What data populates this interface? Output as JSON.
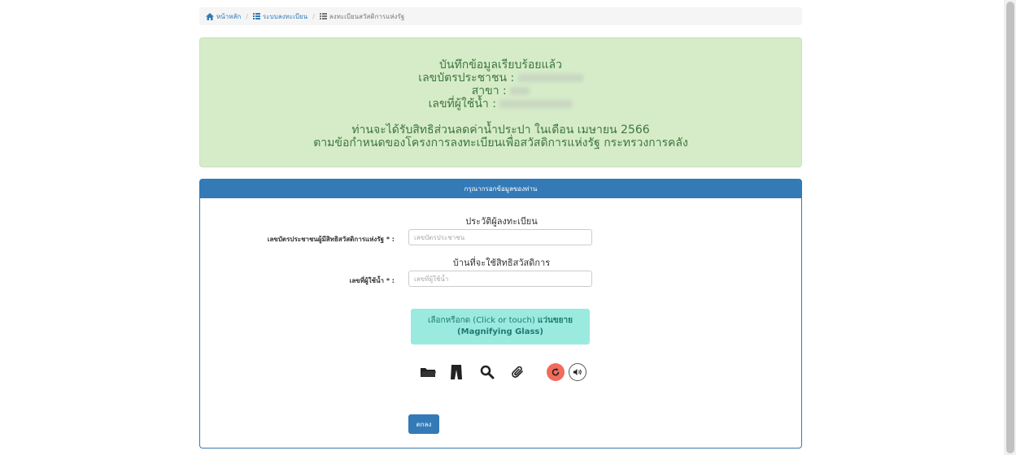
{
  "breadcrumb": {
    "home": "หน้าหลัก",
    "registration": "ระบบลงทะเบียน",
    "current": "ลงทะเบียนสวัสดิการแห่งรัฐ"
  },
  "alert": {
    "saved": "บันทึกข้อมูลเรียบร้อยแล้ว",
    "id_label": "เลขบัตรประชาชน :",
    "branch_label": "สาขา :",
    "user_no_label": "เลขที่ผู้ใช้น้ำ :",
    "discount_line": "ท่านจะได้รับสิทธิส่วนลดค่าน้ำประปา ในเดือน เมษายน 2566",
    "terms_line": "ตามข้อกำหนดของโครงการลงทะเบียนเพื่อสวัสดิการแห่งรัฐ กระทรวงการคลัง"
  },
  "panel": {
    "heading": "กรุณากรอกข้อมูลของท่าน",
    "section_registrant": "ประวัติผู้ลงทะเบียน",
    "id_field_label": "เลขบัตรประชาชนผู้มีสิทธิสวัสดิการแห่งรัฐ * :",
    "id_field_placeholder": "เลขบัตรประชาชน",
    "section_house": "บ้านที่จะใช้สิทธิสวัสดิการ",
    "user_no_field_label": "เลขที่ผู้ใช้น้ำ * :",
    "user_no_field_placeholder": "เลขที่ผู้ใช้น้ำ",
    "magnify_line1": "เลือกหรือกด (Click or touch)",
    "magnify_bold": "แว่นขยาย",
    "magnify_line2": "(Magnifying Glass)",
    "ok_button": "ตกลง"
  },
  "toolbar_icons": [
    "folder-icon",
    "pants-icon",
    "magnifier-icon",
    "paperclip-icon",
    "refresh-icon",
    "audio-icon"
  ],
  "colors": {
    "primary": "#337ab7",
    "alert_bg": "#d6ecc9",
    "magnify_bg": "#9beae0",
    "refresh_bg": "#f26b5b"
  }
}
